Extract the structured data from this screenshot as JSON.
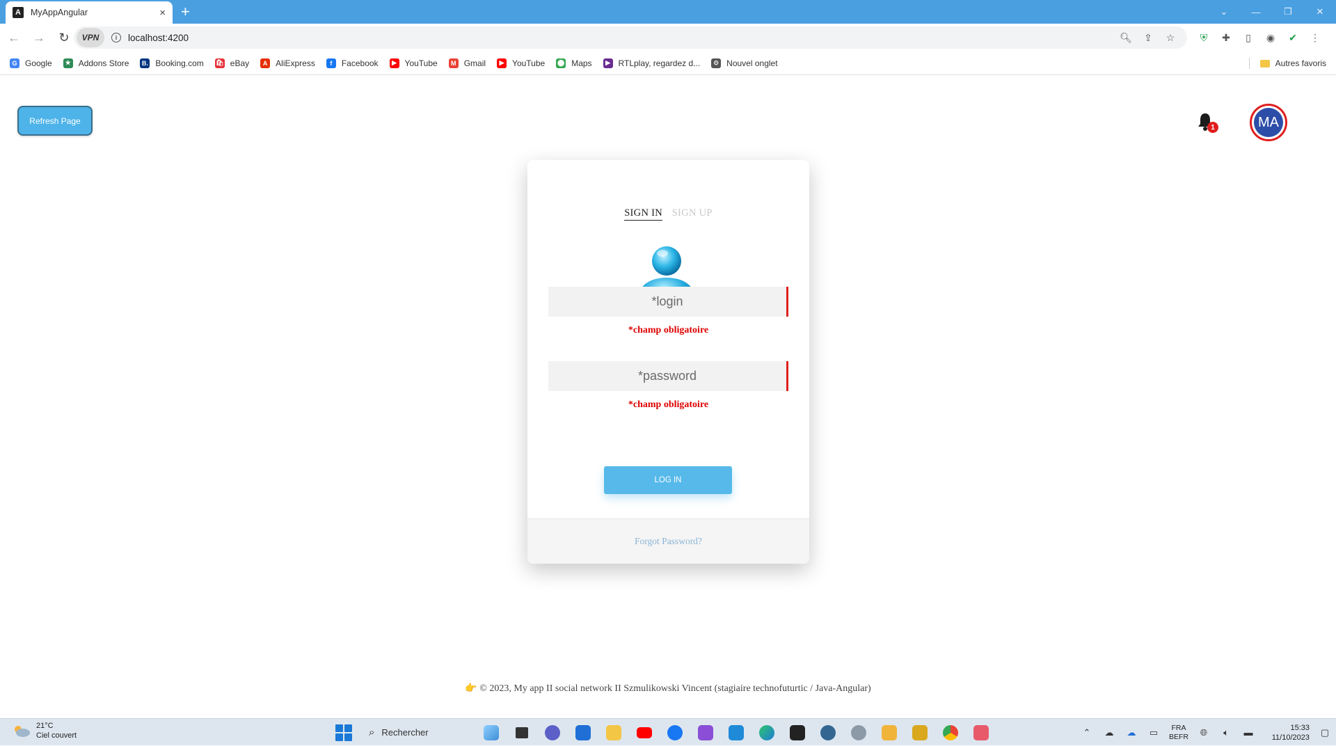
{
  "browser": {
    "tab_title": "MyAppAngular",
    "tab_favicon": "A",
    "tab_close": "×",
    "new_tab": "+",
    "vpn_badge": "VPN",
    "url": "localhost:4200",
    "bookmarks": [
      {
        "label": "Google",
        "icon": "G",
        "color": "#4285f4"
      },
      {
        "label": "Addons Store",
        "icon": "★",
        "color": "#2e8b57"
      },
      {
        "label": "Booking.com",
        "icon": "B.",
        "color": "#003580"
      },
      {
        "label": "eBay",
        "icon": "🛍",
        "color": "#e53238"
      },
      {
        "label": "AliExpress",
        "icon": "A",
        "color": "#e62e04"
      },
      {
        "label": "Facebook",
        "icon": "f",
        "color": "#1877f2"
      },
      {
        "label": "YouTube",
        "icon": "▶",
        "color": "#ff0000"
      },
      {
        "label": "Gmail",
        "icon": "M",
        "color": "#ea4335"
      },
      {
        "label": "YouTube",
        "icon": "▶",
        "color": "#ff0000"
      },
      {
        "label": "Maps",
        "icon": "⬤",
        "color": "#34a853"
      },
      {
        "label": "RTLplay, regardez d...",
        "icon": "▶",
        "color": "#6a2c91"
      },
      {
        "label": "Nouvel onglet",
        "icon": "⊙",
        "color": "#555555"
      }
    ],
    "other_bookmarks": "Autres favoris"
  },
  "page": {
    "refresh_label": "Refresh Page",
    "notification_count": "1",
    "avatar_initials": "MA",
    "auth": {
      "tab_signin": "SIGN IN",
      "tab_signup": "SIGN UP",
      "login_placeholder": "*login",
      "password_placeholder": "*password",
      "login_error": "*champ obligatoire",
      "password_error": "*champ obligatoire",
      "submit_label": "LOG IN",
      "forgot_label": "Forgot Password?"
    },
    "footer_text": "👉 © 2023, My app II social network II Szmulikowski Vincent (stagiaire technofuturtic / Java-Angular)"
  },
  "taskbar": {
    "temperature": "21°C",
    "weather": "Ciel couvert",
    "search_label": "Rechercher",
    "lang_1": "FRA",
    "lang_2": "BEFR",
    "time": "15:33",
    "date": "11/10/2023"
  },
  "colors": {
    "accent": "#56b9ea",
    "error": "#e01e1e",
    "avatar_bg": "#2c4ea8"
  }
}
